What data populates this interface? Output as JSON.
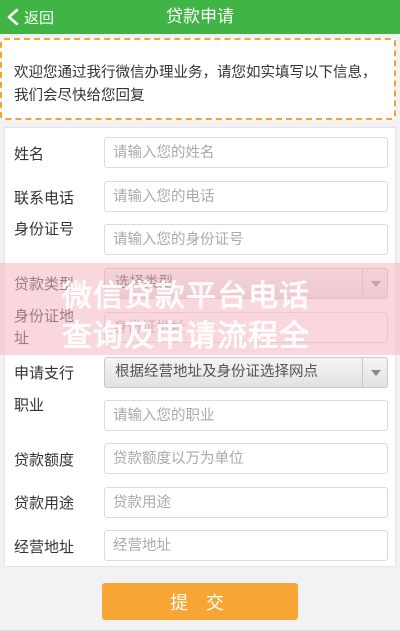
{
  "header": {
    "back_label": "返回",
    "title": "贷款申请"
  },
  "notice": {
    "text": "欢迎您通过我行微信办理业务，请您如实填写以下信息，我们会尽快给您回复"
  },
  "form": {
    "name": {
      "label": "姓名",
      "placeholder": "请输入您的姓名"
    },
    "phone": {
      "label": "联系电话",
      "placeholder": "请输入您的电话"
    },
    "id_number": {
      "label": "身份证号",
      "placeholder": "请输入您的身份证号"
    },
    "loan_type": {
      "label": "贷款类型",
      "selected": "选择类型"
    },
    "id_address": {
      "label": "身份证地址",
      "placeholder": "身份证地址"
    },
    "branch": {
      "label": "申请支行",
      "selected": "根据经营地址及身份证选择网点"
    },
    "occupation": {
      "label": "职业",
      "placeholder": "请输入您的职业"
    },
    "amount": {
      "label": "贷款额度",
      "placeholder": "贷款额度以万为单位"
    },
    "purpose": {
      "label": "贷款用途",
      "placeholder": "贷款用途"
    },
    "business_address": {
      "label": "经营地址",
      "placeholder": "经营地址"
    }
  },
  "watermark": {
    "line1": "微信贷款平台电话",
    "line2": "查询及申请流程全"
  },
  "submit_label": "提 交",
  "colors": {
    "header": "#41b446",
    "accent": "#f7a534",
    "notice_border": "#f2a43a"
  }
}
